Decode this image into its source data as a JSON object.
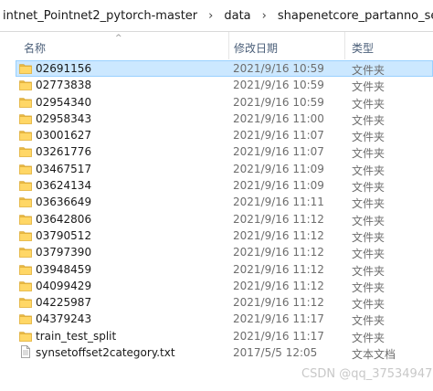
{
  "breadcrumb": [
    "intnet_Pointnet2_pytorch-master",
    "data",
    "shapenetcore_partanno_segmentation_benchm"
  ],
  "columns": {
    "name": "名称",
    "date": "修改日期",
    "type": "类型"
  },
  "rows": [
    {
      "name": "02691156",
      "date": "2021/9/16 10:59",
      "type": "文件夹",
      "icon": "folder-icon",
      "selected": true
    },
    {
      "name": "02773838",
      "date": "2021/9/16 10:59",
      "type": "文件夹",
      "icon": "folder-icon"
    },
    {
      "name": "02954340",
      "date": "2021/9/16 10:59",
      "type": "文件夹",
      "icon": "folder-icon"
    },
    {
      "name": "02958343",
      "date": "2021/9/16 11:00",
      "type": "文件夹",
      "icon": "folder-icon"
    },
    {
      "name": "03001627",
      "date": "2021/9/16 11:07",
      "type": "文件夹",
      "icon": "folder-icon"
    },
    {
      "name": "03261776",
      "date": "2021/9/16 11:07",
      "type": "文件夹",
      "icon": "folder-icon"
    },
    {
      "name": "03467517",
      "date": "2021/9/16 11:09",
      "type": "文件夹",
      "icon": "folder-icon"
    },
    {
      "name": "03624134",
      "date": "2021/9/16 11:09",
      "type": "文件夹",
      "icon": "folder-icon"
    },
    {
      "name": "03636649",
      "date": "2021/9/16 11:11",
      "type": "文件夹",
      "icon": "folder-icon"
    },
    {
      "name": "03642806",
      "date": "2021/9/16 11:12",
      "type": "文件夹",
      "icon": "folder-icon"
    },
    {
      "name": "03790512",
      "date": "2021/9/16 11:12",
      "type": "文件夹",
      "icon": "folder-icon"
    },
    {
      "name": "03797390",
      "date": "2021/9/16 11:12",
      "type": "文件夹",
      "icon": "folder-icon"
    },
    {
      "name": "03948459",
      "date": "2021/9/16 11:12",
      "type": "文件夹",
      "icon": "folder-icon"
    },
    {
      "name": "04099429",
      "date": "2021/9/16 11:12",
      "type": "文件夹",
      "icon": "folder-icon"
    },
    {
      "name": "04225987",
      "date": "2021/9/16 11:12",
      "type": "文件夹",
      "icon": "folder-icon"
    },
    {
      "name": "04379243",
      "date": "2021/9/16 11:17",
      "type": "文件夹",
      "icon": "folder-icon"
    },
    {
      "name": "train_test_split",
      "date": "2021/9/16 11:17",
      "type": "文件夹",
      "icon": "folder-icon"
    },
    {
      "name": "synsetoffset2category.txt",
      "date": "2017/5/5 12:05",
      "type": "文本文档",
      "icon": "text-file-icon"
    }
  ],
  "watermark": "CSDN @qq_37534947",
  "colors": {
    "folder": "#ffd766",
    "selection": "#cce8ff",
    "selection_border": "#99d1ff"
  }
}
